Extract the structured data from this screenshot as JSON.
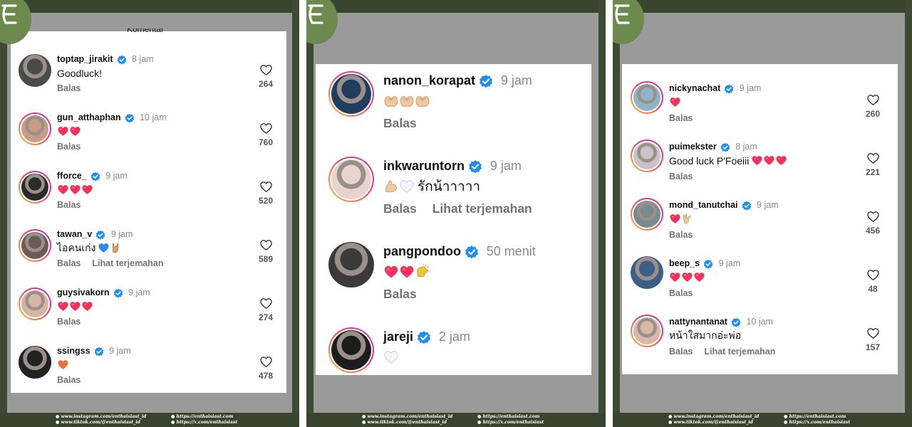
{
  "colors": {
    "background": "#9a9a9a",
    "frame": "#3e4a34",
    "logo": "#6c8a4e",
    "verified": "#1f8ef1",
    "heart_emoji": "#f0325c",
    "orange_heart": "#e2743e",
    "muted": "#8a8a8a"
  },
  "footer": {
    "instagram": "● www.instagram.com/enthaisiast_id",
    "tiktok": "● www.tiktok.com/@enthaisiast_id",
    "website": "● https://enthaisiast.com",
    "x": "● https://x.com/enthaisiast"
  },
  "panel1": {
    "header": "Komentar",
    "comments": [
      {
        "username": "toptap_jirakit",
        "time": "8 jam",
        "text": "Goodluck!",
        "actions": [
          "Balas"
        ],
        "likes": "264"
      },
      {
        "username": "gun_atthaphan",
        "time": "10 jam",
        "text": "",
        "emoji": [
          "heart",
          "heart"
        ],
        "actions": [
          "Balas"
        ],
        "likes": "760"
      },
      {
        "username": "fforce_",
        "time": "9 jam",
        "text": "",
        "emoji": [
          "heart",
          "heart",
          "heart"
        ],
        "actions": [
          "Balas"
        ],
        "likes": "520"
      },
      {
        "username": "tawan_v",
        "time": "9 jam",
        "text": "ไอคนเก่ง",
        "emoji": [
          "blue-heart",
          "rock-hand"
        ],
        "actions": [
          "Balas",
          "Lihat terjemahan"
        ],
        "likes": "589"
      },
      {
        "username": "guysivakorn",
        "time": "9 jam",
        "text": "",
        "emoji": [
          "heart",
          "heart",
          "heart"
        ],
        "actions": [
          "Balas"
        ],
        "likes": "274"
      },
      {
        "username": "ssingss",
        "time": "9 jam",
        "text": "",
        "emoji": [
          "orange-heart"
        ],
        "actions": [
          "Balas"
        ],
        "likes": "478"
      }
    ]
  },
  "panel2": {
    "comments": [
      {
        "username": "nanon_korapat",
        "time": "9 jam",
        "text": "",
        "emoji": [
          "heart-hands",
          "heart-hands",
          "heart-hands"
        ],
        "actions": [
          "Balas"
        ]
      },
      {
        "username": "inkwaruntorn",
        "time": "9 jam",
        "text": "รักน้าาาาา",
        "emoji": [
          "flexed-biceps",
          "white-heart"
        ],
        "actions": [
          "Balas",
          "Lihat terjemahan"
        ]
      },
      {
        "username": "pangpondoo",
        "time": "50 menit",
        "text": "",
        "emoji": [
          "heart",
          "heart",
          "clapping-hands"
        ],
        "actions": [
          "Balas"
        ]
      },
      {
        "username": "jareji",
        "time": "2 jam",
        "text": "",
        "emoji": [
          "white-heart"
        ],
        "actions": []
      }
    ]
  },
  "panel3": {
    "comments": [
      {
        "username": "nickynachat",
        "time": "9 jam",
        "text": "",
        "emoji": [
          "heart"
        ],
        "actions": [
          "Balas"
        ],
        "likes": "260"
      },
      {
        "username": "puimekster",
        "time": "8 jam",
        "text": "Good luck P'Foeiii",
        "emoji": [
          "heart",
          "heart",
          "heart"
        ],
        "actions": [
          "Balas"
        ],
        "likes": "221"
      },
      {
        "username": "mond_tanutchai",
        "time": "9 jam",
        "text": "",
        "emoji": [
          "heart",
          "love-you-gesture"
        ],
        "actions": [
          "Balas"
        ],
        "likes": "456"
      },
      {
        "username": "beep_s",
        "time": "9 jam",
        "text": "",
        "emoji": [
          "heart",
          "heart",
          "heart"
        ],
        "actions": [
          "Balas"
        ],
        "likes": "48"
      },
      {
        "username": "nattynantanat",
        "time": "10 jam",
        "text": "หน้าใสมากอ่ะพ่อ",
        "emoji": [],
        "actions": [
          "Balas",
          "Lihat terjemahan"
        ],
        "likes": "157"
      }
    ]
  }
}
